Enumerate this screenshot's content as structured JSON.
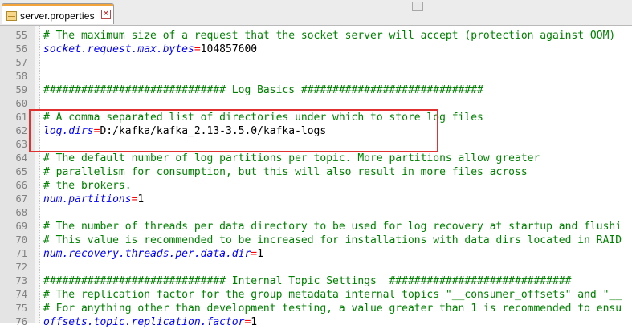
{
  "tab": {
    "label": "server.properties",
    "close_glyph": "✕"
  },
  "editor": {
    "lines": [
      {
        "num": "55",
        "segments": [
          {
            "type": "comment",
            "text": "# The maximum size of a request that the socket server will accept (protection against OOM)"
          }
        ]
      },
      {
        "num": "56",
        "segments": [
          {
            "type": "key",
            "text": "socket.request.max.bytes"
          },
          {
            "type": "op",
            "text": "="
          },
          {
            "type": "val",
            "text": "104857600"
          }
        ]
      },
      {
        "num": "57",
        "segments": []
      },
      {
        "num": "58",
        "segments": []
      },
      {
        "num": "59",
        "segments": [
          {
            "type": "comment",
            "text": "############################# Log Basics #############################"
          }
        ]
      },
      {
        "num": "60",
        "segments": []
      },
      {
        "num": "61",
        "segments": [
          {
            "type": "comment",
            "text": "# A comma separated list of directories under which to store log files"
          }
        ]
      },
      {
        "num": "62",
        "segments": [
          {
            "type": "key",
            "text": "log.dirs"
          },
          {
            "type": "op",
            "text": "="
          },
          {
            "type": "val",
            "text": "D:/kafka/kafka_2.13-3.5.0/kafka-logs"
          }
        ]
      },
      {
        "num": "63",
        "segments": []
      },
      {
        "num": "64",
        "segments": [
          {
            "type": "comment",
            "text": "# The default number of log partitions per topic. More partitions allow greater"
          }
        ]
      },
      {
        "num": "65",
        "segments": [
          {
            "type": "comment",
            "text": "# parallelism for consumption, but this will also result in more files across"
          }
        ]
      },
      {
        "num": "66",
        "segments": [
          {
            "type": "comment",
            "text": "# the brokers."
          }
        ]
      },
      {
        "num": "67",
        "segments": [
          {
            "type": "key",
            "text": "num.partitions"
          },
          {
            "type": "op",
            "text": "="
          },
          {
            "type": "val",
            "text": "1"
          }
        ]
      },
      {
        "num": "68",
        "segments": []
      },
      {
        "num": "69",
        "segments": [
          {
            "type": "comment",
            "text": "# The number of threads per data directory to be used for log recovery at startup and flushi"
          }
        ]
      },
      {
        "num": "70",
        "segments": [
          {
            "type": "comment",
            "text": "# This value is recommended to be increased for installations with data dirs located in RAID"
          }
        ]
      },
      {
        "num": "71",
        "segments": [
          {
            "type": "key",
            "text": "num.recovery.threads.per.data.dir"
          },
          {
            "type": "op",
            "text": "="
          },
          {
            "type": "val",
            "text": "1"
          }
        ]
      },
      {
        "num": "72",
        "segments": []
      },
      {
        "num": "73",
        "segments": [
          {
            "type": "comment",
            "text": "############################# Internal Topic Settings  #############################"
          }
        ]
      },
      {
        "num": "74",
        "segments": [
          {
            "type": "comment",
            "text": "# The replication factor for the group metadata internal topics \"__consumer_offsets\" and \"__"
          }
        ]
      },
      {
        "num": "75",
        "segments": [
          {
            "type": "comment",
            "text": "# For anything other than development testing, a value greater than 1 is recommended to ensu"
          }
        ]
      },
      {
        "num": "76",
        "segments": [
          {
            "type": "key",
            "text": "offsets.topic.replication.factor"
          },
          {
            "type": "op",
            "text": "="
          },
          {
            "type": "val",
            "text": "1"
          }
        ]
      }
    ]
  },
  "colors": {
    "comment": "#008000",
    "key": "#0000ff",
    "operator": "#ff0000",
    "highlight_box": "#e03030"
  },
  "icons": [
    "file-icon",
    "close-icon"
  ]
}
